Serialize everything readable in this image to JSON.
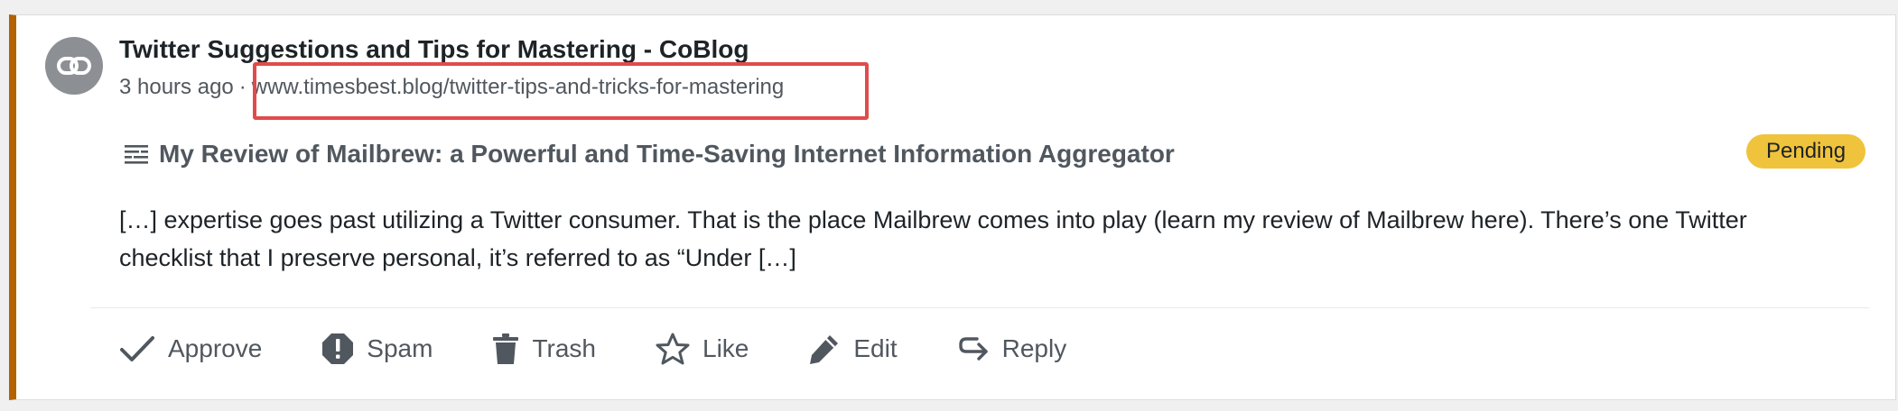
{
  "comment": {
    "title": "Twitter Suggestions and Tips for Mastering - CoBlog",
    "time": "3 hours ago",
    "separator": "·",
    "url": "www.timesbest.blog/twitter-tips-and-tricks-for-mastering",
    "post_title": "My Review of Mailbrew: a Powerful and Time-Saving Internet Information Aggregator",
    "status": "Pending",
    "excerpt": "[…] expertise goes past utilizing a Twitter consumer. That is the place Mailbrew comes into play (learn my review of Mailbrew here). There’s one Twitter checklist that I preserve personal, it’s referred to as “Under […]"
  },
  "actions": {
    "approve": "Approve",
    "spam": "Spam",
    "trash": "Trash",
    "like": "Like",
    "edit": "Edit",
    "reply": "Reply"
  },
  "colors": {
    "pending_border": "#b26200",
    "badge": "#f0c33c",
    "highlight": "#e14b4b"
  },
  "icons": [
    "link-icon",
    "post-icon",
    "check-icon",
    "spam-icon",
    "trash-icon",
    "star-icon",
    "pencil-icon",
    "reply-icon"
  ]
}
